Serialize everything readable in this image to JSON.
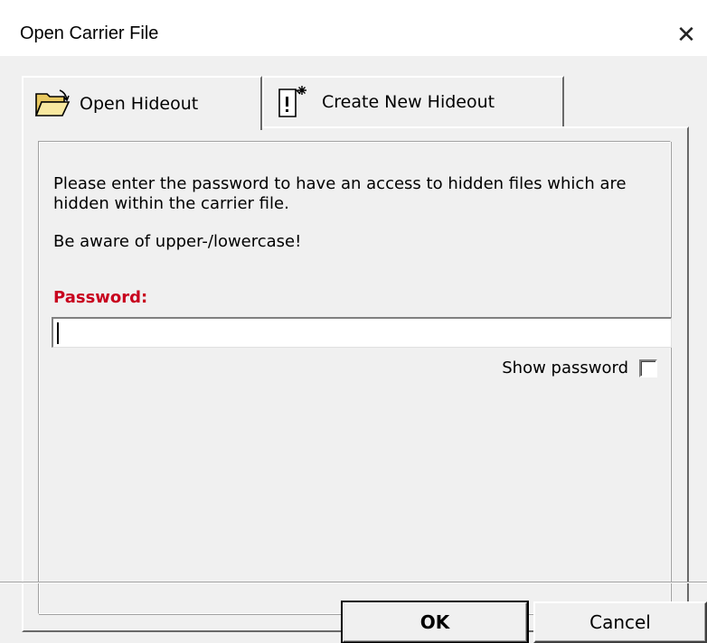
{
  "window": {
    "title": "Open Carrier File",
    "close_glyph": "✕"
  },
  "tabs": [
    {
      "label": "Open Hideout",
      "icon": "open-folder-icon",
      "active": true
    },
    {
      "label": "Create New Hideout",
      "icon": "new-document-icon",
      "active": false
    }
  ],
  "panel": {
    "description": "Please enter the password to have an access to hidden files which are hidden within the carrier file.",
    "note": "Be aware of upper-/lowercase!",
    "password_label": "Password:",
    "password_value": "",
    "show_password_label": "Show password",
    "show_password_checked": false
  },
  "buttons": {
    "ok": "OK",
    "cancel": "Cancel"
  },
  "colors": {
    "label_red": "#c8001e",
    "background": "#f0f0f0",
    "titlebar": "#ffffff"
  }
}
